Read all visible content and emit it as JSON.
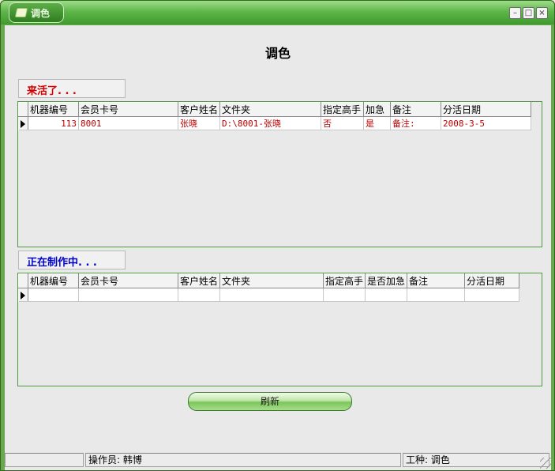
{
  "window": {
    "title": "调色",
    "buttons": {
      "minimize": "–",
      "maximize": "□",
      "close": "×"
    }
  },
  "page": {
    "heading": "调色"
  },
  "incoming": {
    "label": "来活了. . .",
    "columns": [
      "机器编号",
      "会员卡号",
      "客户姓名",
      "文件夹",
      "指定高手",
      "加急",
      "备注",
      "分活日期"
    ],
    "rows": [
      {
        "machine_no": "113",
        "member_card": "8001",
        "customer": "张晓",
        "folder": "D:\\8001-张晓",
        "expert": "否",
        "urgent": "是",
        "remark": "备注:",
        "date": "2008-3-5"
      }
    ]
  },
  "in_progress": {
    "label": "正在制作中. . .",
    "columns": [
      "机器编号",
      "会员卡号",
      "客户姓名",
      "文件夹",
      "指定高手",
      "是否加急",
      "备注",
      "分活日期"
    ]
  },
  "refresh_button": "刷新",
  "status": {
    "operator": "操作员: 韩博",
    "job_type": "工种: 调色"
  },
  "colors": {
    "accent": "#5fb64a",
    "alert_red": "#d40000",
    "progress_blue": "#0000cc"
  }
}
